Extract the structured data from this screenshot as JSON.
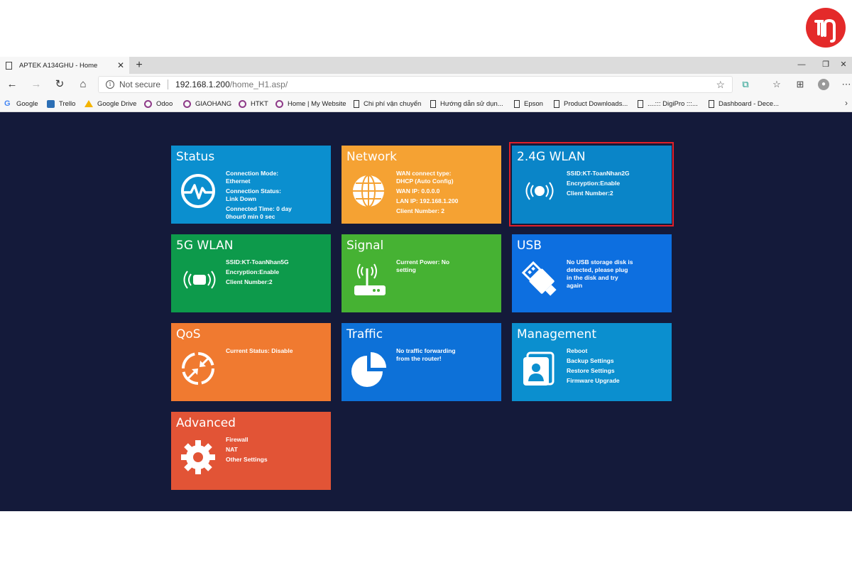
{
  "browser": {
    "tab_title": "APTEK A134GHU - Home",
    "tab_close": "✕",
    "new_tab": "+",
    "window_controls": {
      "minimize": "—",
      "restore": "❐",
      "close": "✕"
    },
    "address": {
      "security_text": "Not secure",
      "host": "192.168.1.200",
      "path": "/home_H1.asp/"
    },
    "bookmarks": [
      {
        "label": "Google",
        "icon": "google-icon"
      },
      {
        "label": "Trello",
        "icon": "trello-icon"
      },
      {
        "label": "Google Drive",
        "icon": "google-drive-icon"
      },
      {
        "label": "Odoo",
        "icon": "odoo-icon"
      },
      {
        "label": "GIAOHANG",
        "icon": "odoo-icon"
      },
      {
        "label": "HTKT",
        "icon": "odoo-icon"
      },
      {
        "label": "Home | My Website",
        "icon": "odoo-icon"
      },
      {
        "label": "Chi phí vận chuyển",
        "icon": "page-icon"
      },
      {
        "label": "Hướng dẫn sử dụn...",
        "icon": "page-icon"
      },
      {
        "label": "Epson",
        "icon": "page-icon"
      },
      {
        "label": "Product Downloads...",
        "icon": "page-icon"
      },
      {
        "label": "....::: DigiPro :::...",
        "icon": "page-icon"
      },
      {
        "label": "Dashboard - Dece...",
        "icon": "page-icon"
      }
    ]
  },
  "tiles": {
    "status": {
      "title": "Status",
      "color": "#0b8fcf",
      "lines": [
        "Connection Mode:\nEthernet",
        "Connection Status:\nLink Down",
        "Connected Time: 0 day\n0hour0 min 0 sec"
      ]
    },
    "network": {
      "title": "Network",
      "color": "#f5a233",
      "lines": [
        "WAN connect type:\nDHCP (Auto Config)",
        "WAN IP: 0.0.0.0",
        "LAN IP: 192.168.1.200",
        "Client Number: 2"
      ]
    },
    "wlan24": {
      "title": "2.4G WLAN",
      "color": "#0a85c8",
      "lines": [
        "SSID:KT-ToanNhan2G",
        "Encryption:Enable",
        "Client Number:2"
      ]
    },
    "wlan5": {
      "title": "5G WLAN",
      "color": "#0d9a4b",
      "lines": [
        "SSID:KT-ToanNhan5G",
        "Encryption:Enable",
        "Client Number:2"
      ]
    },
    "signal": {
      "title": "Signal",
      "color": "#46b233",
      "lines": [
        "Current Power: No\nsetting"
      ]
    },
    "usb": {
      "title": "USB",
      "color": "#0d6fe0",
      "lines": [
        "No USB storage disk is\ndetected, please plug\nin the disk and try\nagain"
      ]
    },
    "qos": {
      "title": "QoS",
      "color": "#f07a30",
      "lines": [
        "Current Status: Disable"
      ]
    },
    "traffic": {
      "title": "Traffic",
      "color": "#0d71d8",
      "lines": [
        "No traffic forwarding\nfrom the router!"
      ]
    },
    "management": {
      "title": "Management",
      "color": "#0b8fcf",
      "lines": [
        "Reboot",
        "Backup Settings",
        "Restore Settings",
        "Firmware Upgrade"
      ]
    },
    "advanced": {
      "title": "Advanced",
      "color": "#e25436",
      "lines": [
        "Firewall",
        "NAT",
        "Other Settings"
      ]
    }
  },
  "highlight_color": "#e0202a",
  "content_background": "#141a3a"
}
